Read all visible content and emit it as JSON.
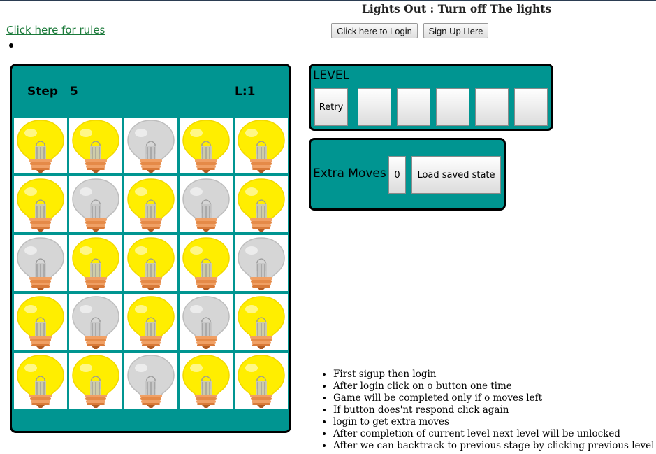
{
  "header": {
    "title": "Lights Out : Turn off The lights",
    "rules_link": "Click here for rules",
    "login_button": "Click here to Login",
    "signup_button": "Sign Up Here"
  },
  "board": {
    "step_label": "Step",
    "step_value": "5",
    "level_indicator": "L:1",
    "bulbs": [
      [
        true,
        true,
        false,
        true,
        true
      ],
      [
        true,
        false,
        true,
        false,
        true
      ],
      [
        false,
        true,
        true,
        true,
        false
      ],
      [
        true,
        false,
        true,
        false,
        true
      ],
      [
        true,
        true,
        false,
        true,
        true
      ]
    ]
  },
  "level_panel": {
    "title": "LEVEL",
    "retry_label": "Retry",
    "level_buttons": [
      "",
      "",
      "",
      "",
      ""
    ]
  },
  "extra_panel": {
    "label": "Extra Moves",
    "count": "0",
    "load_label": "Load saved state"
  },
  "rules": [
    "First sigup then login",
    "After login click on o button one time",
    "Game will be completed only if o moves left",
    "If button does'nt respond click again",
    "login to get extra moves",
    "After completion of current level next level will be unlocked",
    "After we can backtrack to previous stage by clicking previous level"
  ],
  "colors": {
    "panel": "#009591",
    "bulb_on": "#ffee00",
    "bulb_off": "#d4d4d4",
    "link": "#1b7a3a"
  }
}
